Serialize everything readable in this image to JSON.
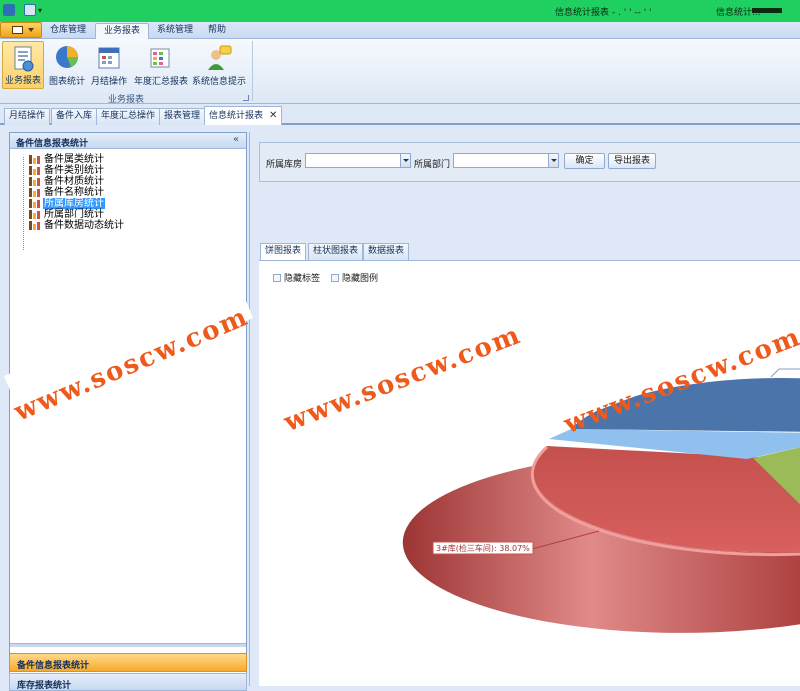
{
  "titlebar": {
    "window_title": "信息统计报表 - . ' ' -- ' '",
    "right_text": "信息统计..."
  },
  "ribbon": {
    "tabs": [
      {
        "label": "仓库管理"
      },
      {
        "label": "业务报表"
      },
      {
        "label": "系统管理"
      },
      {
        "label": "帮助"
      }
    ],
    "buttons": [
      {
        "label": "业务报表"
      },
      {
        "label": "图表统计"
      },
      {
        "label": "月结操作"
      },
      {
        "label": "年度汇总报表"
      },
      {
        "label": "系统信息提示"
      }
    ],
    "group_label": "业务报表"
  },
  "doc_tabs": [
    {
      "label": "月结操作"
    },
    {
      "label": "备件入库"
    },
    {
      "label": "年度汇总操作"
    },
    {
      "label": "报表管理"
    },
    {
      "label": "信息统计报表"
    }
  ],
  "left_nav": {
    "header": "备件信息报表统计",
    "collapse_glyph": "«",
    "items": [
      {
        "label": "备件属类统计"
      },
      {
        "label": "备件类别统计"
      },
      {
        "label": "备件材质统计"
      },
      {
        "label": "备件名称统计"
      },
      {
        "label": "所属库房统计"
      },
      {
        "label": "所属部门统计"
      },
      {
        "label": "备件数据动态统计"
      }
    ],
    "groups": [
      {
        "label": "备件信息报表统计"
      },
      {
        "label": "库存报表统计"
      }
    ]
  },
  "filters": {
    "warehouse_label": "所属库房",
    "warehouse_value": "",
    "department_label": "所属部门",
    "department_value": "",
    "confirm_label": "确定",
    "export_label": "导出报表"
  },
  "chart_tabs": [
    {
      "label": "饼图报表"
    },
    {
      "label": "柱状图报表"
    },
    {
      "label": "数据报表"
    }
  ],
  "chart_options": {
    "hide_labels": "隐藏标签",
    "hide_legend": "隐藏图例"
  },
  "watermark": "www.soscw.com",
  "chart_data": {
    "type": "pie",
    "title": "",
    "slices": [
      {
        "label": "3#库(检三车间): 38.07%",
        "value": 38.07,
        "color": "#c9504f"
      },
      {
        "label": "",
        "value": 30,
        "color": "#4b74aa"
      },
      {
        "label": "",
        "value": 4,
        "color": "#8fc0ee"
      },
      {
        "label": "",
        "value": 6,
        "color": "#9bbb59"
      }
    ],
    "colors": {
      "red": "#c9504f",
      "blue": "#4b74aa",
      "light_blue": "#8fc0ee",
      "green": "#9bbb59"
    }
  },
  "colors": {
    "titlebar": "#1fcf5f",
    "app_button": "#f0a218",
    "selection": "#3399ff",
    "watermark": "#ee5a1c"
  }
}
